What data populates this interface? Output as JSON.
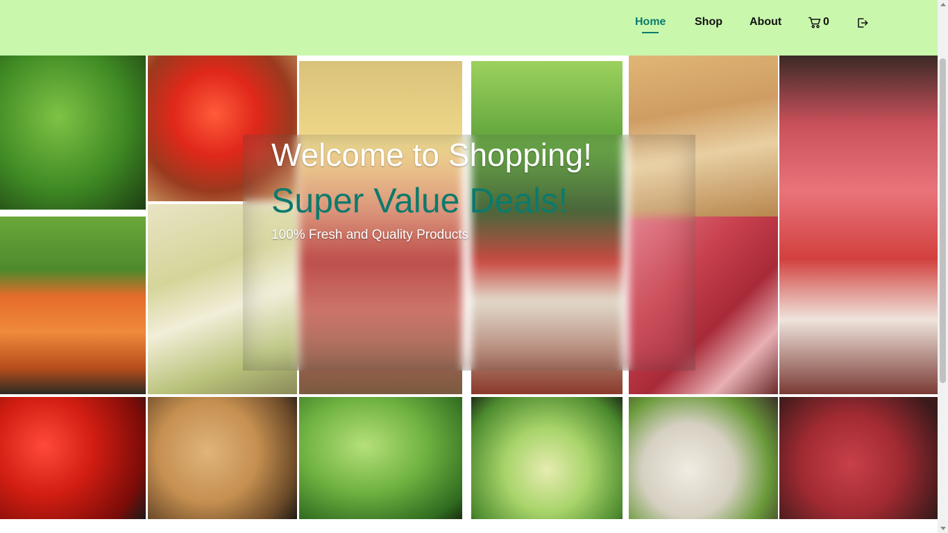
{
  "nav": {
    "items": [
      {
        "label": "Home",
        "active": true
      },
      {
        "label": "Shop",
        "active": false
      },
      {
        "label": "About",
        "active": false
      }
    ],
    "cart_icon": "cart-icon",
    "cart_count": "0",
    "logout_icon": "logout-icon",
    "active_color": "#0c7a6c",
    "background_color": "#c9f8ad"
  },
  "hero": {
    "title": "Welcome to Shopping!",
    "subtitle": "Super Value Deals!",
    "tagline": "100% Fresh and Quality Products",
    "subtitle_color": "#0c7a6c",
    "background": "photo collage of fresh vegetables and raw meat"
  }
}
